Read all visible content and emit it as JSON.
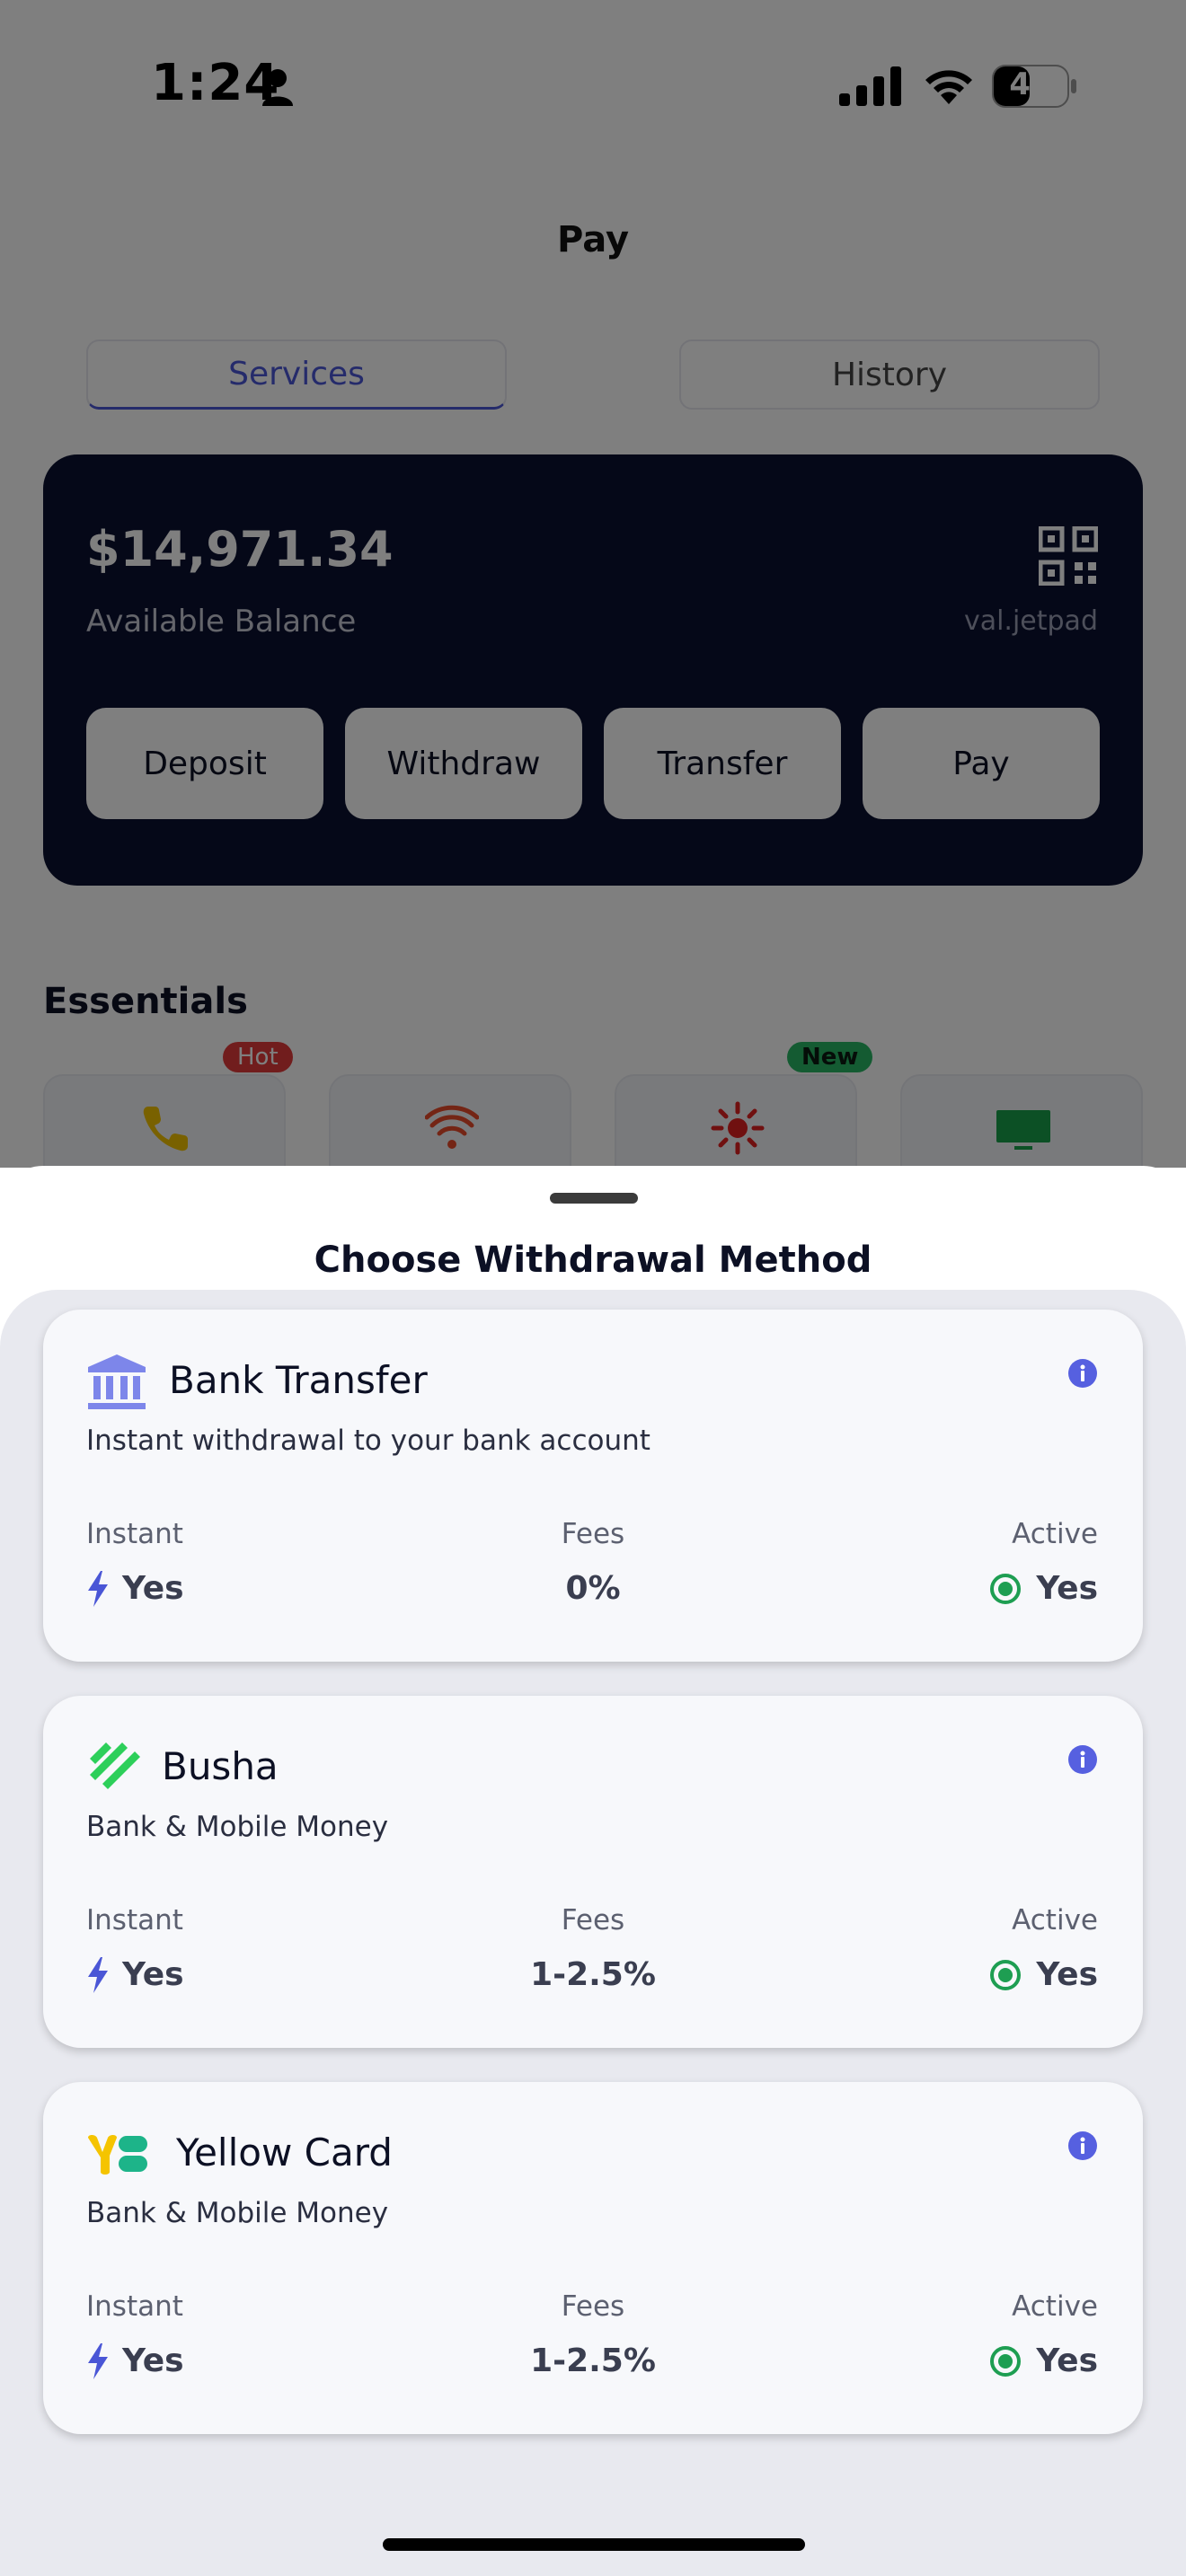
{
  "status_bar": {
    "time": "1:24",
    "battery": "45"
  },
  "nav": {
    "title": "Pay"
  },
  "tabs": [
    {
      "label": "Services"
    },
    {
      "label": "History"
    }
  ],
  "balance_card": {
    "amount": "$14,971.34",
    "label": "Available Balance",
    "handle": "val.jetpad",
    "actions": [
      {
        "label": "Deposit"
      },
      {
        "label": "Withdraw"
      },
      {
        "label": "Transfer"
      },
      {
        "label": "Pay"
      }
    ]
  },
  "essentials": {
    "title": "Essentials",
    "badges": {
      "hot": "Hot",
      "new": "New"
    },
    "tiles": [
      {
        "icon": "phone-icon"
      },
      {
        "icon": "wifi-icon"
      },
      {
        "icon": "sun-icon"
      },
      {
        "icon": "tv-icon"
      }
    ]
  },
  "sheet": {
    "title": "Choose Withdrawal Method",
    "meta_labels": {
      "instant": "Instant",
      "fees": "Fees",
      "active": "Active"
    },
    "methods": [
      {
        "name": "Bank Transfer",
        "desc": "Instant withdrawal to your bank account",
        "instant": "Yes",
        "fees": "0%",
        "active": "Yes",
        "icon": "bank-icon"
      },
      {
        "name": "Busha",
        "desc": "Bank & Mobile Money",
        "instant": "Yes",
        "fees": "1-2.5%",
        "active": "Yes",
        "icon": "busha-logo-icon"
      },
      {
        "name": "Yellow Card",
        "desc": "Bank & Mobile Money",
        "instant": "Yes",
        "fees": "1-2.5%",
        "active": "Yes",
        "icon": "yellow-card-logo-icon"
      }
    ]
  },
  "colors": {
    "accent": "#4a56d6",
    "card_dark": "#0b1030",
    "active_green": "#1e9e52",
    "hot_badge": "#e23b3b",
    "new_badge": "#29b765"
  }
}
